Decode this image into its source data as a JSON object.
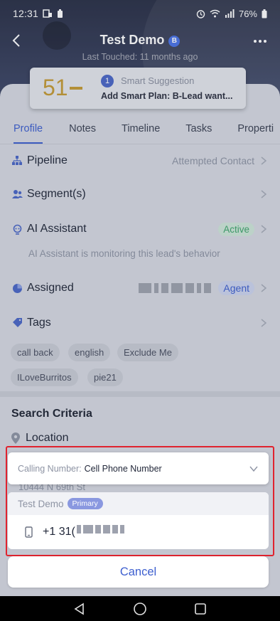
{
  "status_bar": {
    "time": "12:31",
    "battery": "76%"
  },
  "header": {
    "title": "Test Demo",
    "badge": "B",
    "last_touched": "Last Touched: 11 months ago"
  },
  "score_card": {
    "score": "51",
    "suggestion_count": "1",
    "suggestion_title": "Smart Suggestion",
    "suggestion_text": "Add Smart Plan: B-Lead want..."
  },
  "tabs": [
    {
      "label": "Profile",
      "active": true
    },
    {
      "label": "Notes",
      "active": false
    },
    {
      "label": "Timeline",
      "active": false
    },
    {
      "label": "Tasks",
      "active": false
    },
    {
      "label": "Properti",
      "active": false
    }
  ],
  "profile": {
    "pipeline_label": "Pipeline",
    "pipeline_value": "Attempted Contact",
    "segments_label": "Segment(s)",
    "ai_label": "AI Assistant",
    "ai_status": "Active",
    "ai_note": "AI Assistant is monitoring this lead's behavior",
    "assigned_label": "Assigned",
    "assigned_role": "Agent",
    "tags_label": "Tags",
    "tags": [
      "call back",
      "english",
      "Exclude Me",
      "ILoveBurritos",
      "pie21"
    ]
  },
  "search_criteria": {
    "title": "Search Criteria",
    "location_label": "Location",
    "address": "10444 N 69th St"
  },
  "call_sheet": {
    "calling_label": "Calling Number:",
    "calling_value": "Cell Phone Number",
    "contact_name": "Test Demo",
    "primary_label": "Primary",
    "phone_prefix": "+1 31(",
    "cancel_label": "Cancel"
  },
  "colors": {
    "accent": "#3d5fcf",
    "score": "#c49a34",
    "active_green": "#3ea56b",
    "highlight_red": "#e0232f"
  }
}
